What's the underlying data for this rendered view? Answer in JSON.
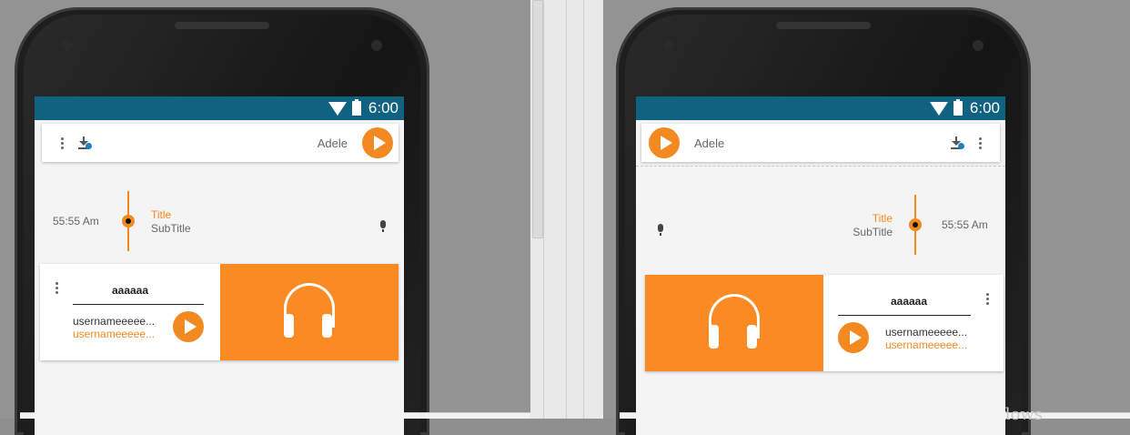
{
  "status": {
    "time": "6:00"
  },
  "left": {
    "bar": {
      "artist": "Adele"
    },
    "timeline": {
      "time": "55:55 Am",
      "title": "Title",
      "subtitle": "SubTitle"
    },
    "media": {
      "title": "aaaaaa",
      "user1": "usernameeeee...",
      "user2": "usernameeeee..."
    }
  },
  "right": {
    "bar": {
      "artist": "Adele"
    },
    "timeline": {
      "time": "55:55 Am",
      "title": "Title",
      "subtitle": "SubTitle"
    },
    "media": {
      "title": "aaaaaa",
      "user1": "usernameeeee...",
      "user2": "usernameeeee..."
    }
  },
  "watermark": "Activate Windows",
  "colors": {
    "accent": "#f28a21",
    "statusbar": "#0f6381",
    "media": "#fb8a22"
  },
  "icons": [
    "wifi-icon",
    "battery-icon",
    "more-vert-icon",
    "download-done-icon",
    "play-icon",
    "mic-icon",
    "headphones-icon"
  ]
}
